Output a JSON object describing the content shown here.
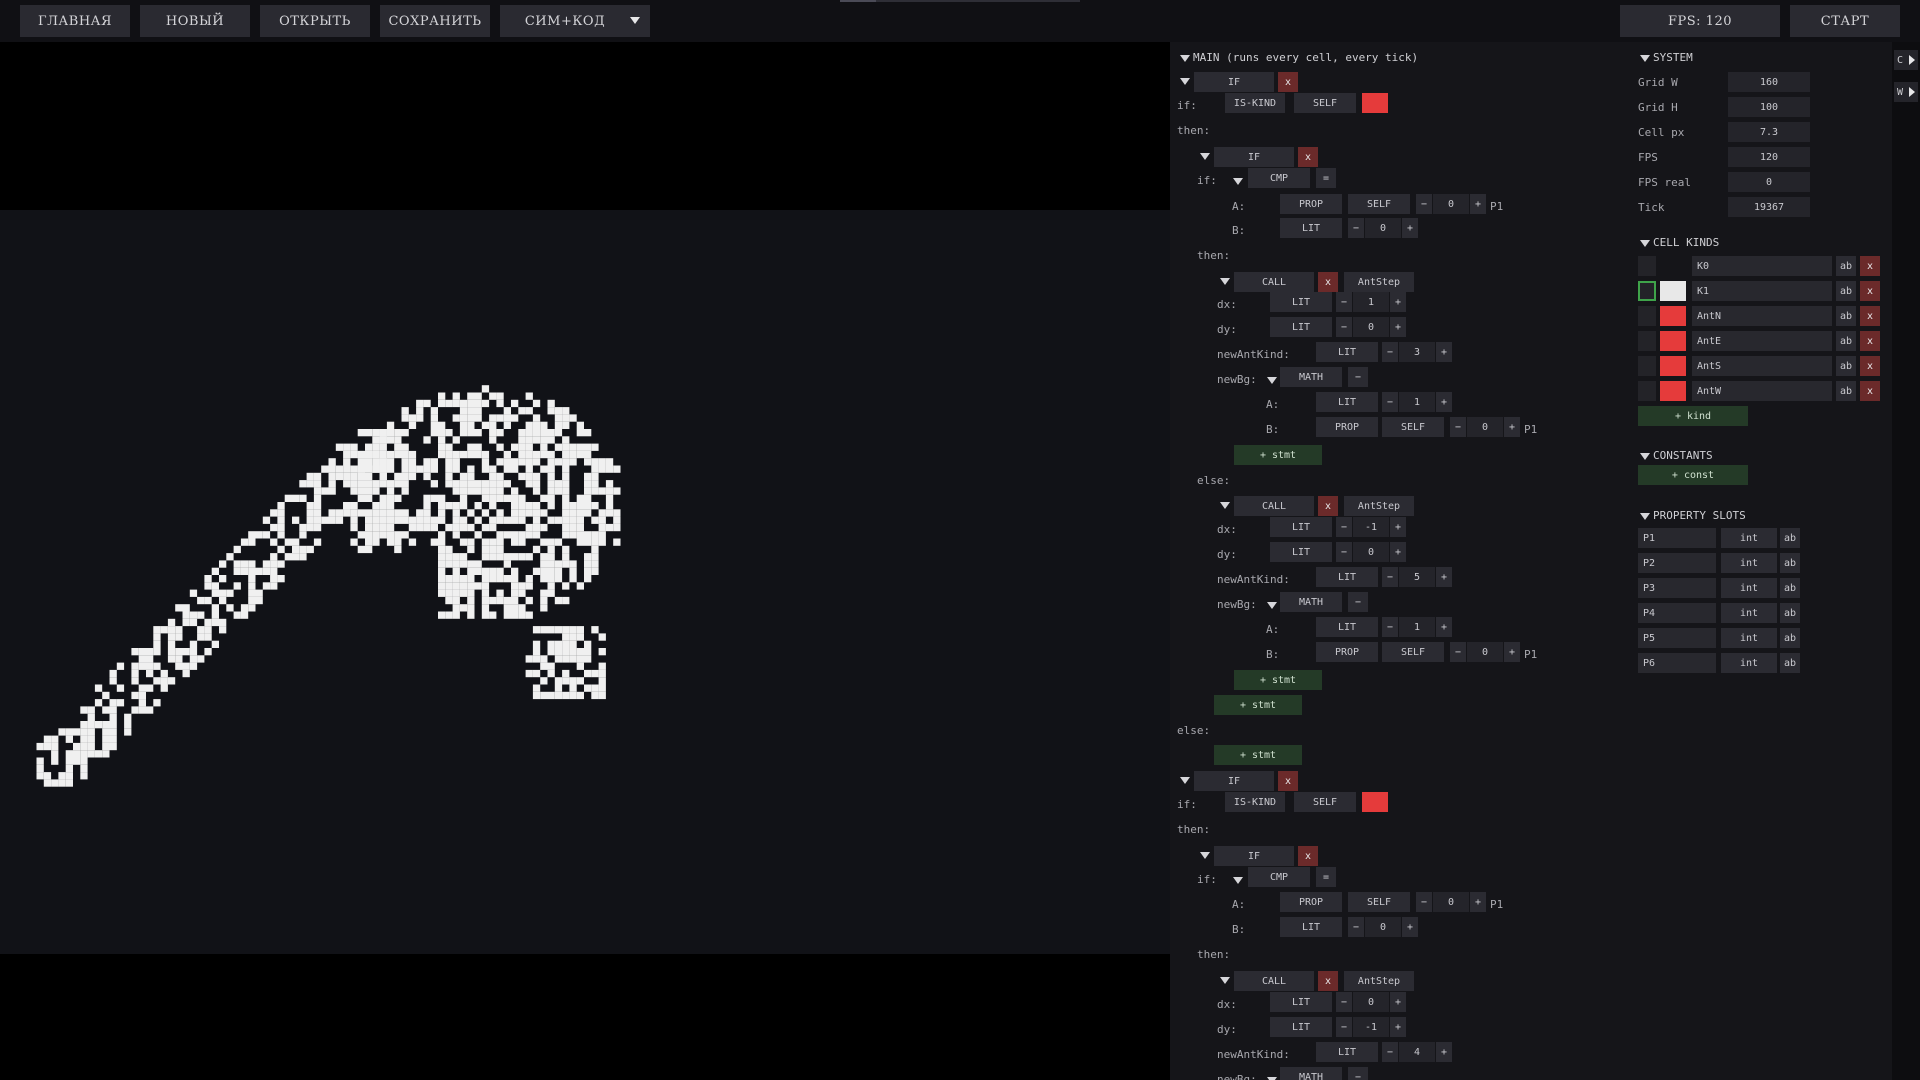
{
  "topbar": {
    "buttons": [
      "ГЛАВНАЯ",
      "НОВЫЙ",
      "ОТКРЫТЬ",
      "СОХРАНИТЬ",
      "СИМ+КОД"
    ],
    "fps_label": "FPS: 120",
    "start_label": "СТАРТ",
    "progress": 0.15
  },
  "code": {
    "main_header": "MAIN (runs every cell, every tick)",
    "if_label": "IF",
    "x": "x",
    "if_prefix": "if:",
    "then_label": "then:",
    "else_label": "else:",
    "is_kind": "IS-KIND",
    "self": "SELF",
    "cmp": "CMP",
    "eq": "=",
    "a_label": "A:",
    "b_label": "B:",
    "prop": "PROP",
    "lit": "LIT",
    "p1": "P1",
    "minus": "−",
    "plus": "+",
    "call": "CALL",
    "ant_step": "AntStep",
    "dx_label": "dx:",
    "dy_label": "dy:",
    "new_ant_kind_label": "newAntKind:",
    "new_bg_label": "newBg:",
    "math": "MATH",
    "math_op": "−",
    "add_stmt": "+ stmt",
    "values": {
      "cmp_a": "0",
      "cmp_b": "0",
      "t_dx": "1",
      "t_dy": "0",
      "t_kind": "3",
      "t_bg_a": "1",
      "t_bg_b": "0",
      "e_dx": "-1",
      "e_dy": "0",
      "e_kind": "5",
      "e_bg_a": "1",
      "e_bg_b": "0",
      "s_cmp_a": "0",
      "s_cmp_b": "0",
      "s_dx": "0",
      "s_dy": "-1",
      "s_kind": "4"
    }
  },
  "system": {
    "header": "SYSTEM",
    "rows": [
      {
        "label": "Grid W",
        "value": "160"
      },
      {
        "label": "Grid H",
        "value": "100"
      },
      {
        "label": "Cell px",
        "value": "7.3"
      },
      {
        "label": "FPS",
        "value": "120"
      },
      {
        "label": "FPS real",
        "value": "0"
      },
      {
        "label": "Tick",
        "value": "19367"
      }
    ]
  },
  "cell_kinds": {
    "header": "CELL KINDS",
    "ab": "ab",
    "x": "x",
    "add_label": "+ kind",
    "items": [
      {
        "name": "K0",
        "color": "#151519",
        "selected": false
      },
      {
        "name": "K1",
        "color": "#e8e8e8",
        "selected": true
      },
      {
        "name": "AntN",
        "color": "#e53b3b",
        "selected": false
      },
      {
        "name": "AntE",
        "color": "#e53b3b",
        "selected": false
      },
      {
        "name": "AntS",
        "color": "#e53b3b",
        "selected": false
      },
      {
        "name": "AntW",
        "color": "#e53b3b",
        "selected": false
      }
    ]
  },
  "constants": {
    "header": "CONSTANTS",
    "add_label": "+ const"
  },
  "property_slots": {
    "header": "PROPERTY SLOTS",
    "ab": "ab",
    "items": [
      {
        "name": "P1",
        "type": "int"
      },
      {
        "name": "P2",
        "type": "int"
      },
      {
        "name": "P3",
        "type": "int"
      },
      {
        "name": "P4",
        "type": "int"
      },
      {
        "name": "P5",
        "type": "int"
      },
      {
        "name": "P6",
        "type": "int"
      }
    ]
  },
  "edge": {
    "buttons": [
      "C",
      "W"
    ]
  },
  "colors": {
    "accent_red": "#e53b3b",
    "add_green": "#243a27",
    "delete_red": "#6b2a2a",
    "cell_white": "#f0f0f0"
  }
}
